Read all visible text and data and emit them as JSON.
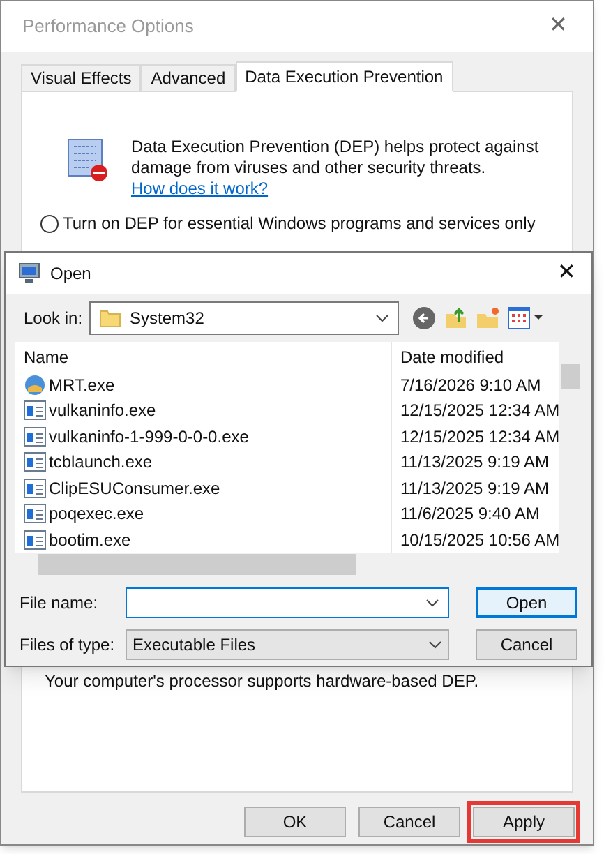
{
  "window": {
    "title": "Performance Options",
    "close": "✕"
  },
  "tabs": [
    {
      "label": "Visual Effects",
      "selected": false
    },
    {
      "label": "Advanced",
      "selected": false
    },
    {
      "label": "Data Execution Prevention",
      "selected": true
    }
  ],
  "dep": {
    "description": "Data Execution Prevention (DEP) helps protect against damage from viruses and other security threats.",
    "link": "How does it work?",
    "options": [
      {
        "label": "Turn on DEP for essential Windows programs and services only",
        "selected": false
      }
    ],
    "support_note": "Your computer's processor supports hardware-based DEP."
  },
  "buttons": [
    {
      "label": "OK",
      "highlighted": false
    },
    {
      "label": "Cancel",
      "highlighted": false
    },
    {
      "label": "Apply",
      "highlighted": true
    }
  ],
  "open_dialog": {
    "title": "Open",
    "close": "✕",
    "look_in_label": "Look in:",
    "look_in_value": "System32",
    "columns": [
      "Name",
      "Date modified"
    ],
    "files": [
      {
        "name": "MRT.exe",
        "date": "7/16/2026 9:10 AM",
        "kind": "tool"
      },
      {
        "name": "vulkaninfo.exe",
        "date": "12/15/2025 12:34 AM",
        "kind": "app"
      },
      {
        "name": "vulkaninfo-1-999-0-0-0.exe",
        "date": "12/15/2025 12:34 AM",
        "kind": "app"
      },
      {
        "name": "tcblaunch.exe",
        "date": "11/13/2025 9:19 AM",
        "kind": "app"
      },
      {
        "name": "ClipESUConsumer.exe",
        "date": "11/13/2025 9:19 AM",
        "kind": "app"
      },
      {
        "name": "poqexec.exe",
        "date": "11/6/2025 9:40 AM",
        "kind": "app"
      },
      {
        "name": "bootim.exe",
        "date": "10/15/2025 10:56 AM",
        "kind": "app"
      }
    ],
    "file_name_label": "File name:",
    "file_type_label": "Files of type:",
    "file_type_value": "Executable Files",
    "buttons": [
      {
        "label": "Open",
        "default": true
      },
      {
        "label": "Cancel",
        "default": false
      }
    ]
  }
}
